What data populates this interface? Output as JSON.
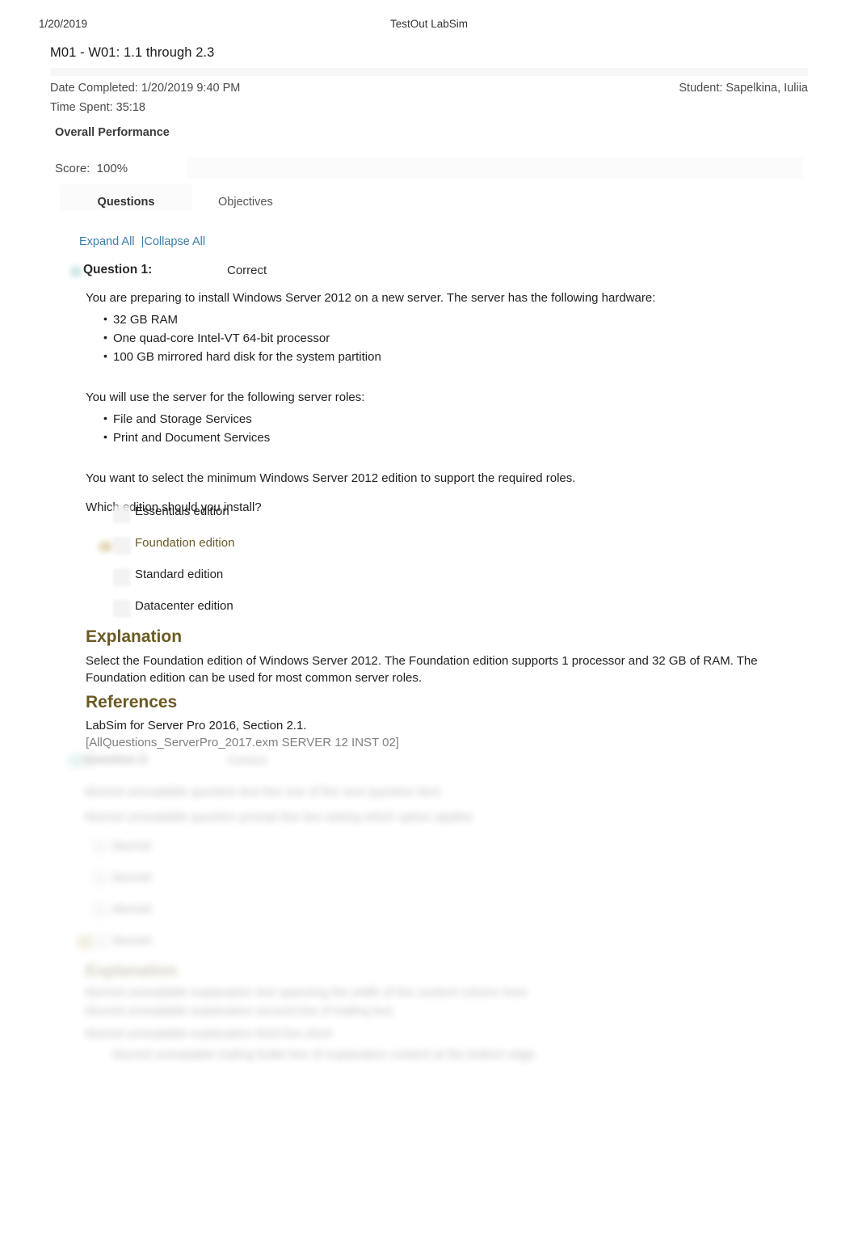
{
  "print_header": {
    "date": "1/20/2019",
    "site_title": "TestOut LabSim"
  },
  "report": {
    "title": "M01 - W01: 1.1 through 2.3",
    "date_completed_label": "Date Completed: 1/20/2019 9:40 PM",
    "time_spent_label": "Time Spent: 35:18",
    "student_label": "Student: Sapelkina, Iuliia"
  },
  "performance": {
    "heading": "Overall Performance",
    "score_label": "Score:  100%",
    "score_value": "100%"
  },
  "tabs": [
    {
      "label": "Questions",
      "active": true
    },
    {
      "label": "Objectives",
      "active": false
    }
  ],
  "controls": {
    "expand_all": "Expand All",
    "separator": "  |",
    "collapse_all": "Collapse All"
  },
  "question": {
    "label": "Question 1:",
    "status": "Correct",
    "intro": "You are preparing to install Windows Server 2012 on a new server. The server has the following hardware:",
    "hardware": [
      "32 GB RAM",
      "One quad-core Intel-VT 64-bit processor",
      "100 GB mirrored hard disk for the system partition"
    ],
    "roles_intro": "You will use the server for the following server roles:",
    "roles": [
      "File and Storage Services",
      "Print and Document Services"
    ],
    "goal": "You want to select the minimum Windows Server 2012 edition to support the required roles.",
    "prompt": "Which edition should you install?",
    "options": [
      {
        "label": "Essentials edition",
        "selected": false
      },
      {
        "label": "Foundation edition",
        "selected": true
      },
      {
        "label": "Standard edition",
        "selected": false
      },
      {
        "label": "Datacenter edition",
        "selected": false
      }
    ],
    "explanation_heading": "Explanation",
    "explanation_body": "Select the Foundation edition of Windows Server 2012. The Foundation edition supports 1 processor and 32 GB of RAM. The Foundation edition can be used for most common server roles.",
    "references_heading": "References",
    "reference_line": "LabSim for Server Pro 2016, Section 2.1.",
    "reference_code": "[AllQuestions_ServerPro_2017.exm SERVER 12 INST 02]"
  },
  "blurred_next_question": {
    "label": "Question 2:",
    "status": "Correct",
    "line1": "blurred unreadable question text line one of the next question item",
    "line2": "blurred unreadable question prompt line two asking which option applies",
    "options": [
      "blurred",
      "blurred",
      "blurred",
      "blurred"
    ],
    "explanation_heading": "Explanation",
    "exp_line1": "blurred unreadable explanation text spanning the width of the content column here",
    "exp_line2": "blurred unreadable explanation second line of trailing text",
    "exp_line3": "blurred unreadable explanation third line short",
    "exp_line4": "blurred unreadable trailing bullet line of explanation content at the bottom edge"
  },
  "colors": {
    "link": "#3d7ea8",
    "accent_gold": "#6b5a23",
    "text": "#1f1f1f",
    "muted": "#808080"
  }
}
